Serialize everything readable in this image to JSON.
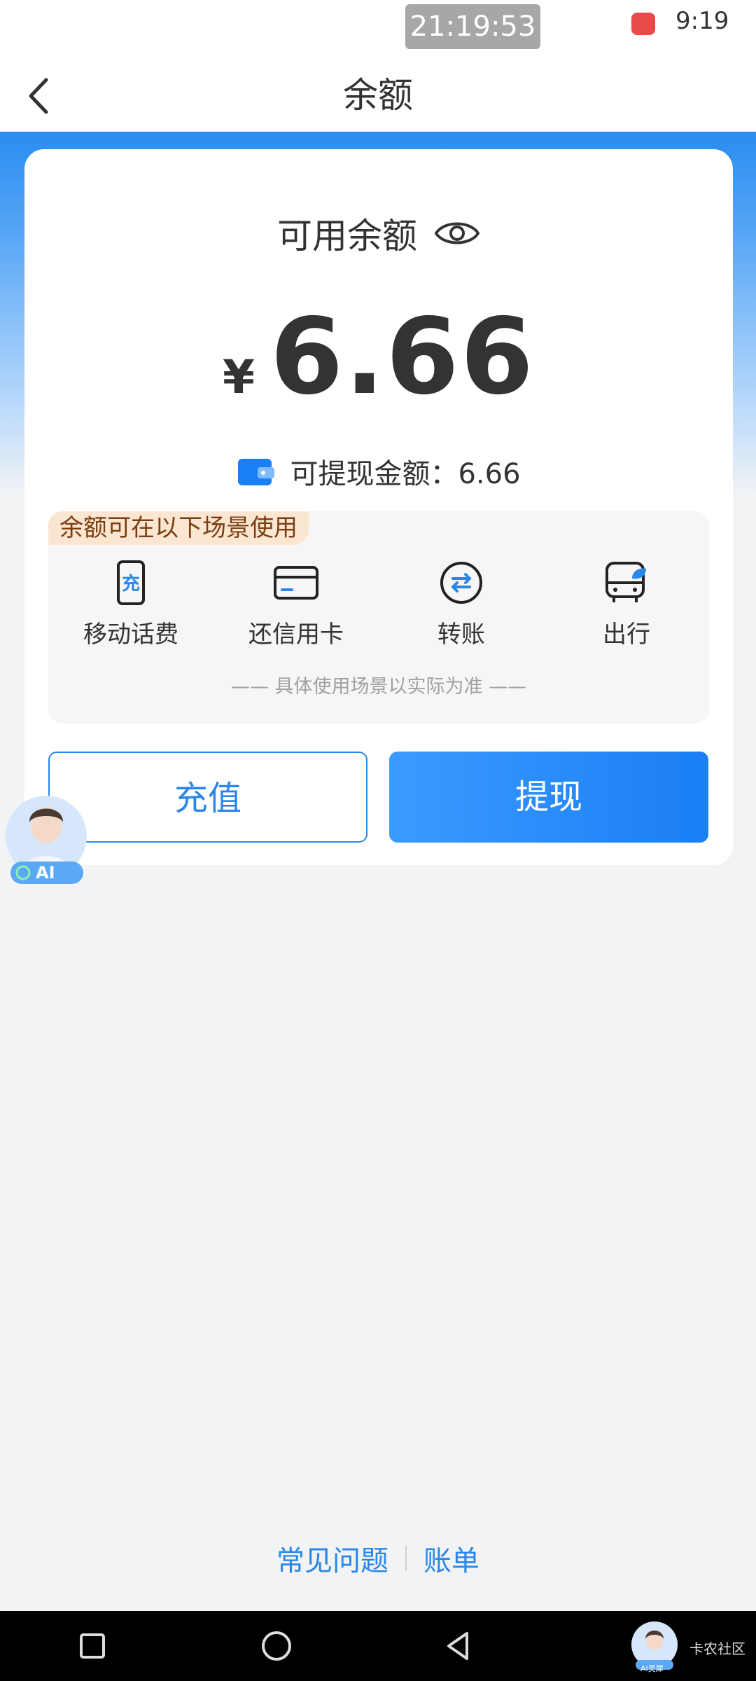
{
  "status_bar": {
    "time_pill": "21:19:53",
    "clock": "9:19"
  },
  "nav": {
    "title": "余额",
    "back_icon": "chevron-left-icon"
  },
  "balance": {
    "label": "可用余额",
    "currency": "¥",
    "amount": "6.66",
    "withdrawable_text": "可提现金额：6.66"
  },
  "scenes": {
    "badge": "余额可在以下场景使用",
    "items": [
      {
        "label": "移动话费",
        "icon": "phone-recharge-icon",
        "glyph": "充"
      },
      {
        "label": "还信用卡",
        "icon": "credit-card-icon"
      },
      {
        "label": "转账",
        "icon": "transfer-icon"
      },
      {
        "label": "出行",
        "icon": "bus-icon"
      }
    ],
    "note": "—— 具体使用场景以实际为准 ——"
  },
  "actions": {
    "recharge": "充值",
    "withdraw": "提现"
  },
  "ai_float": {
    "label": "AI"
  },
  "footer": {
    "faq": "常见问题",
    "bill": "账单"
  },
  "system_nav": {
    "assistant_label": "AI灵犀",
    "watermark": "卡农社区"
  },
  "colors": {
    "accent": "#2a86e8",
    "header_blue": "#2a8cf0",
    "badge_bg": "#fbe6d2"
  }
}
